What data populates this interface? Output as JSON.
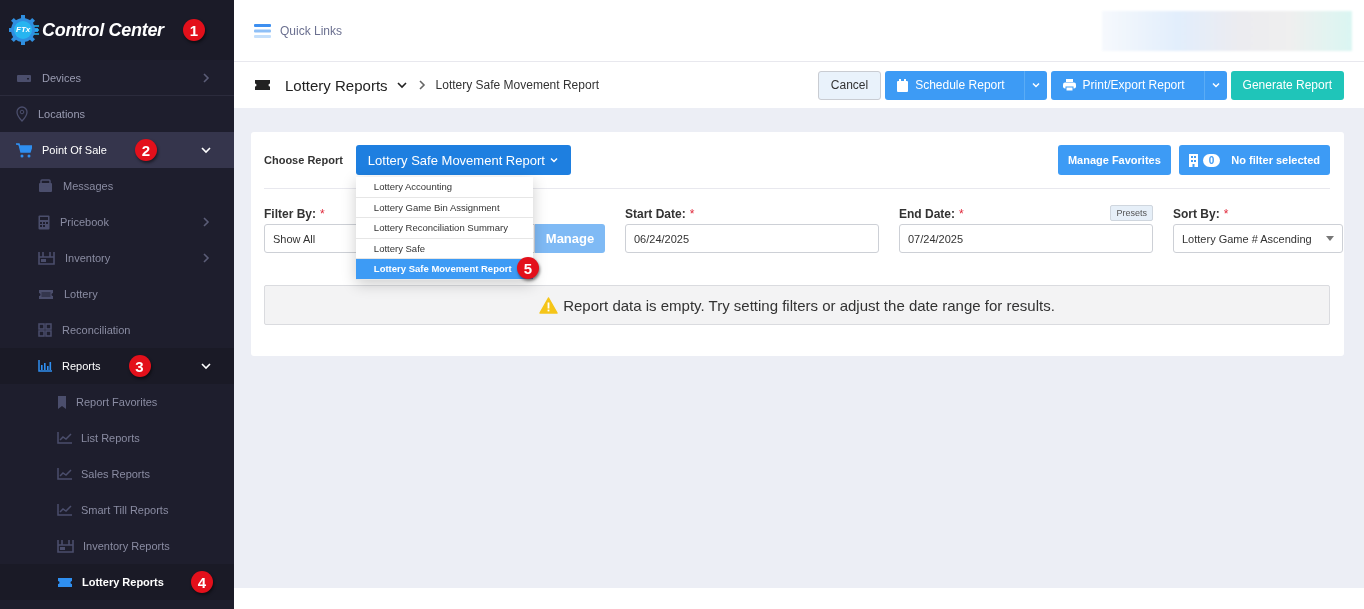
{
  "sidebar": {
    "logo_badge": "FTx",
    "title": "Control Center",
    "callout": "1",
    "items": [
      {
        "label": "Devices",
        "expandable": true,
        "expanded": false,
        "selected": false
      },
      {
        "label": "Locations",
        "expandable": false,
        "expanded": false,
        "selected": false
      },
      {
        "label": "Point Of Sale",
        "expandable": true,
        "expanded": true,
        "selected": false,
        "callout": "2",
        "children": [
          {
            "label": "Messages",
            "expandable": false,
            "expanded": false,
            "selected": false
          },
          {
            "label": "Pricebook",
            "expandable": true,
            "expanded": false,
            "selected": false
          },
          {
            "label": "Inventory",
            "expandable": true,
            "expanded": false,
            "selected": false
          },
          {
            "label": "Lottery",
            "expandable": false,
            "expanded": false,
            "selected": false
          },
          {
            "label": "Reconciliation",
            "expandable": false,
            "expanded": false,
            "selected": false
          },
          {
            "label": "Reports",
            "expandable": true,
            "expanded": true,
            "selected": false,
            "callout": "3",
            "children": [
              {
                "label": "Report Favorites",
                "expandable": false,
                "expanded": false,
                "selected": false
              },
              {
                "label": "List Reports",
                "expandable": false,
                "expanded": false,
                "selected": false
              },
              {
                "label": "Sales Reports",
                "expandable": false,
                "expanded": false,
                "selected": false
              },
              {
                "label": "Smart Till Reports",
                "expandable": false,
                "expanded": false,
                "selected": false
              },
              {
                "label": "Inventory Reports",
                "expandable": false,
                "expanded": false,
                "selected": false
              },
              {
                "label": "Lottery Reports",
                "expandable": false,
                "expanded": false,
                "selected": true,
                "callout": "4"
              }
            ]
          }
        ]
      }
    ]
  },
  "top_bar": {
    "quick_links": "Quick Links"
  },
  "breadcrumb": {
    "section": "Lottery Reports",
    "page": "Lottery Safe Movement Report"
  },
  "actions": [
    {
      "label": "Cancel",
      "kind": "plain"
    },
    {
      "label": "Schedule Report",
      "kind": "split"
    },
    {
      "label": "Print/Export Report",
      "kind": "split"
    },
    {
      "label": "Generate Report",
      "kind": "primary"
    }
  ],
  "report_picker": {
    "label": "Choose Report",
    "value": "Lottery Safe Movement Report",
    "expanded": true,
    "options": [
      {
        "label": "Lottery Accounting",
        "selected": false
      },
      {
        "label": "Lottery Game Bin Assignment",
        "selected": false
      },
      {
        "label": "Lottery Reconciliation Summary",
        "selected": false
      },
      {
        "label": "Lottery Safe",
        "selected": false
      },
      {
        "label": "Lottery Safe Movement Report",
        "selected": true,
        "callout": "5"
      }
    ]
  },
  "header_buttons": {
    "manage_favorites": "Manage Favorites",
    "filter_count": "0",
    "filter_status": "No filter selected"
  },
  "filters": [
    {
      "kind": "select-manage",
      "label": "Filter By:",
      "required_mark": "*",
      "value": "Show All",
      "button": "Manage",
      "button_disabled": true
    },
    {
      "kind": "date",
      "label": "Start Date:",
      "required_mark": "*",
      "value": "06/24/2025"
    },
    {
      "kind": "date",
      "label": "End Date:",
      "required_mark": "*",
      "value": "07/24/2025",
      "button": "Presets"
    },
    {
      "kind": "select",
      "label": "Sort By:",
      "required_mark": "*",
      "value": "Lottery Game # Ascending"
    }
  ],
  "message": "Report data is empty. Try setting filters or adjust the date range for results."
}
